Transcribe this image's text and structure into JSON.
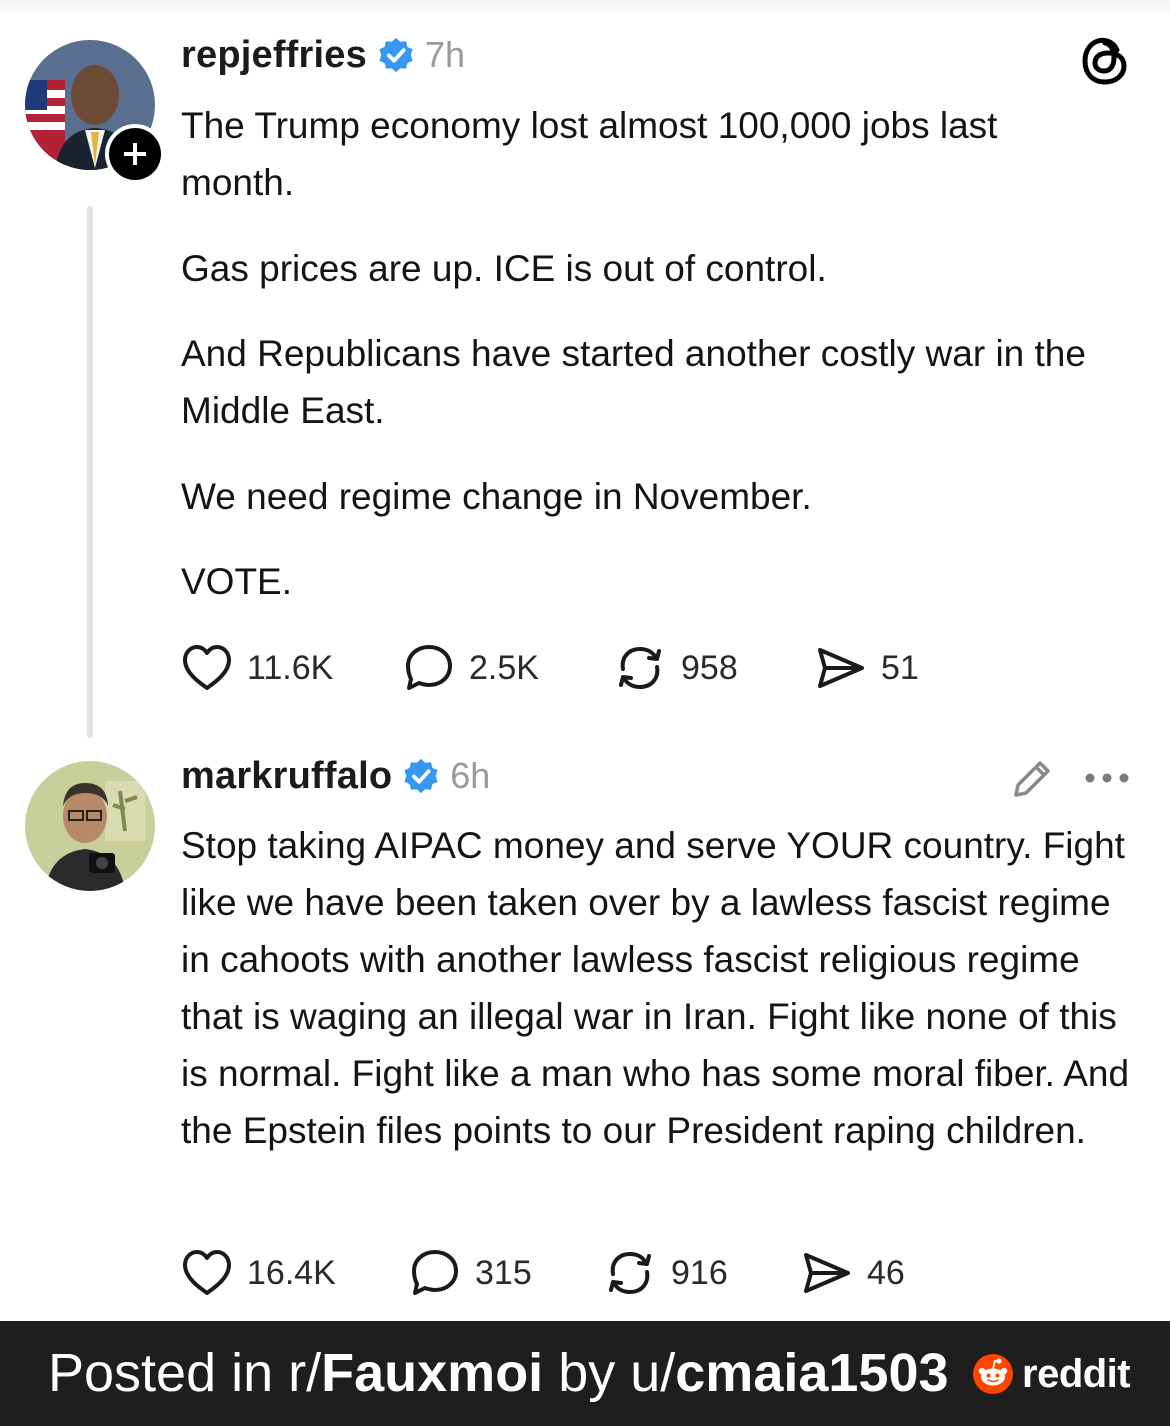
{
  "posts": [
    {
      "username": "repjeffries",
      "time": "7h",
      "paragraphs": [
        "The Trump economy lost almost 100,000 jobs last month.",
        "Gas prices are up. ICE is out of control.",
        "And Republicans have started another costly war in the Middle East.",
        "We need regime change in November.",
        "VOTE."
      ],
      "likes": "11.6K",
      "replies": "2.5K",
      "reposts": "958",
      "shares": "51"
    },
    {
      "username": "markruffalo",
      "time": "6h",
      "text": "Stop taking AIPAC money and serve YOUR country. Fight like we have been taken over by a lawless fascist regime in cahoots with another lawless fascist religious regime that is waging an illegal war in Iran. Fight like none of this is normal. Fight like a man who has some moral fiber. And the Epstein files points to our President raping children.",
      "likes": "16.4K",
      "replies": "315",
      "reposts": "916",
      "shares": "46"
    }
  ],
  "footer": {
    "prefix": "Posted in r/",
    "subreddit": "Fauxmoi",
    "middle": " by u/",
    "user": "cmaia1503",
    "brand": "reddit"
  },
  "icons": {
    "app": "threads-icon",
    "verified_color": "#3897f0",
    "reddit_color": "#ff4500"
  }
}
